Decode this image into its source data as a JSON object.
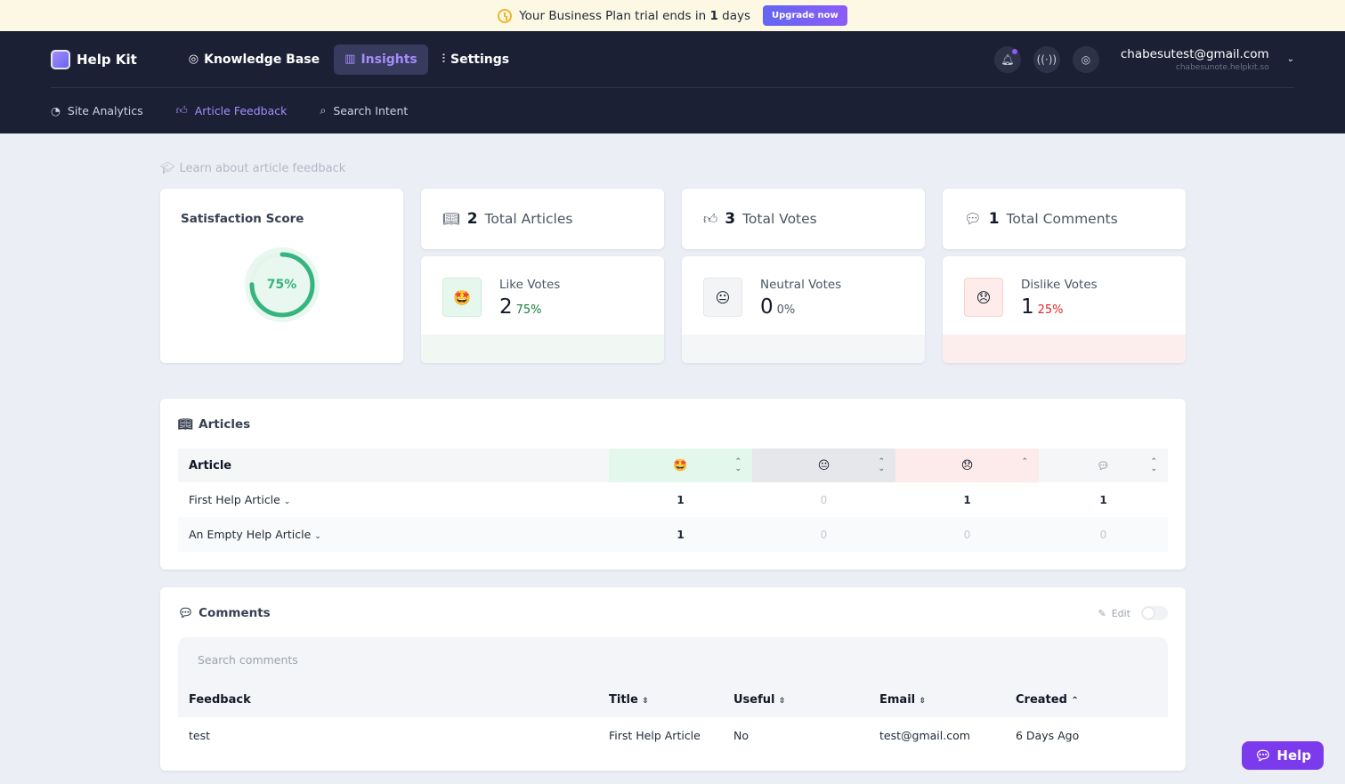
{
  "banner": {
    "prefix": "Your Business Plan trial ends in",
    "days": "1",
    "suffix": "days",
    "button": "Upgrade now"
  },
  "brand": "Help Kit",
  "nav": {
    "kb": "Knowledge Base",
    "insights": "Insights",
    "settings": "Settings"
  },
  "user": {
    "email": "chabesutest@gmail.com",
    "site": "chabesunote.helpkit.so"
  },
  "subnav": {
    "analytics": "Site Analytics",
    "feedback": "Article Feedback",
    "intent": "Search Intent"
  },
  "learn": "Learn about article feedback",
  "satisfaction": {
    "title": "Satisfaction Score",
    "score": "75%",
    "fraction": 0.75
  },
  "totals": {
    "articles": {
      "count": "2",
      "label": "Total Articles"
    },
    "votes": {
      "count": "3",
      "label": "Total Votes"
    },
    "comments": {
      "count": "1",
      "label": "Total Comments"
    }
  },
  "votes": {
    "like": {
      "label": "Like Votes",
      "count": "2",
      "pct": "75%"
    },
    "neutral": {
      "label": "Neutral Votes",
      "count": "0",
      "pct": "0%"
    },
    "dislike": {
      "label": "Dislike Votes",
      "count": "1",
      "pct": "25%"
    }
  },
  "articles": {
    "title": "Articles",
    "header": "Article",
    "rows": [
      {
        "name": "First Help Article",
        "like": "1",
        "neutral": "0",
        "dislike": "1",
        "comments": "1"
      },
      {
        "name": "An Empty Help Article",
        "like": "1",
        "neutral": "0",
        "dislike": "0",
        "comments": "0"
      }
    ]
  },
  "comments": {
    "title": "Comments",
    "edit": "Edit",
    "search_placeholder": "Search comments",
    "headers": {
      "feedback": "Feedback",
      "title": "Title",
      "useful": "Useful",
      "email": "Email",
      "created": "Created"
    },
    "rows": [
      {
        "feedback": "test",
        "title": "First Help Article",
        "useful": "No",
        "email": "test@gmail.com",
        "created": "6 Days Ago"
      }
    ]
  },
  "help_button": "Help",
  "colors": {
    "accent": "#a78bfa",
    "like": "#34b47e",
    "dislike": "#dc2626"
  }
}
